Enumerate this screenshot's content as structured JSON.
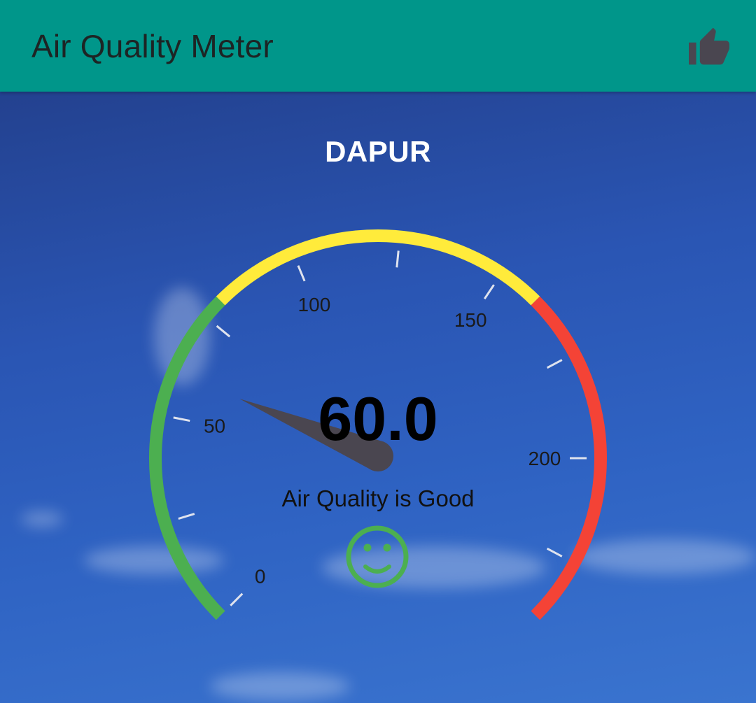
{
  "app_bar": {
    "title": "Air Quality Meter",
    "background_color": "#00968a",
    "action_icon": "thumb-up-icon",
    "action_icon_color": "#4a4650"
  },
  "gauge": {
    "location": "DAPUR",
    "value": 60.0,
    "value_text": "60.0",
    "min": 0,
    "max": 240,
    "tick_labels": [
      "0",
      "50",
      "100",
      "150",
      "200"
    ],
    "ranges": [
      {
        "from": 0,
        "to": 80,
        "color": "#4caf50"
      },
      {
        "from": 80,
        "to": 160,
        "color": "#ffeb3b"
      },
      {
        "from": 160,
        "to": 240,
        "color": "#f44336"
      }
    ],
    "needle_color": "#4a4650",
    "status_text": "Air Quality is Good",
    "status_icon": "smiley-face-icon",
    "status_icon_color": "#4caf50"
  }
}
